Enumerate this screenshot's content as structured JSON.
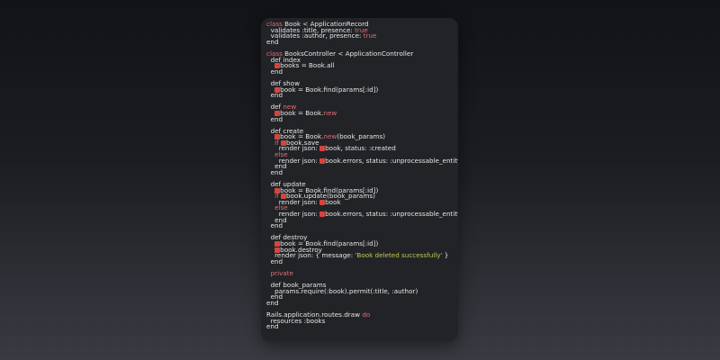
{
  "editor": {
    "accent_keyword": "#e06c75",
    "accent_string": "#c3c94e",
    "lines": [
      [
        {
          "t": "class",
          "c": "kw"
        },
        {
          "t": " Book < ApplicationRecord",
          "c": "tx"
        }
      ],
      [
        {
          "t": "  validates :title, presence: ",
          "c": "tx"
        },
        {
          "t": "true",
          "c": "kw"
        }
      ],
      [
        {
          "t": "  validates :author, presence: ",
          "c": "tx"
        },
        {
          "t": "true",
          "c": "kw"
        }
      ],
      [
        {
          "t": "end",
          "c": "tx"
        }
      ],
      [],
      [
        {
          "t": "class",
          "c": "kw"
        },
        {
          "t": " BooksController < ApplicationController",
          "c": "tx"
        }
      ],
      [
        {
          "t": "  def index",
          "c": "tx"
        }
      ],
      [
        {
          "t": "    ",
          "c": "tx"
        },
        {
          "t": "@",
          "c": "iv"
        },
        {
          "t": "books = Book.all",
          "c": "tx"
        }
      ],
      [
        {
          "t": "  end",
          "c": "tx"
        }
      ],
      [],
      [
        {
          "t": "  def show",
          "c": "tx"
        }
      ],
      [
        {
          "t": "    ",
          "c": "tx"
        },
        {
          "t": "@",
          "c": "iv"
        },
        {
          "t": "book = Book.find(params[:id])",
          "c": "tx"
        }
      ],
      [
        {
          "t": "  end",
          "c": "tx"
        }
      ],
      [],
      [
        {
          "t": "  def ",
          "c": "tx"
        },
        {
          "t": "new",
          "c": "kw"
        }
      ],
      [
        {
          "t": "    ",
          "c": "tx"
        },
        {
          "t": "@",
          "c": "iv"
        },
        {
          "t": "book = Book.",
          "c": "tx"
        },
        {
          "t": "new",
          "c": "kw"
        }
      ],
      [
        {
          "t": "  end",
          "c": "tx"
        }
      ],
      [],
      [
        {
          "t": "  def create",
          "c": "tx"
        }
      ],
      [
        {
          "t": "    ",
          "c": "tx"
        },
        {
          "t": "@",
          "c": "iv"
        },
        {
          "t": "book = Book.",
          "c": "tx"
        },
        {
          "t": "new",
          "c": "kw"
        },
        {
          "t": "(book_params)",
          "c": "tx"
        }
      ],
      [
        {
          "t": "    ",
          "c": "tx"
        },
        {
          "t": "if",
          "c": "kw"
        },
        {
          "t": " ",
          "c": "tx"
        },
        {
          "t": "@",
          "c": "iv"
        },
        {
          "t": "book.save",
          "c": "tx"
        }
      ],
      [
        {
          "t": "      render json: ",
          "c": "tx"
        },
        {
          "t": "@",
          "c": "iv"
        },
        {
          "t": "book, status: :created",
          "c": "tx"
        }
      ],
      [
        {
          "t": "    ",
          "c": "tx"
        },
        {
          "t": "else",
          "c": "kw"
        }
      ],
      [
        {
          "t": "      render json: ",
          "c": "tx"
        },
        {
          "t": "@",
          "c": "iv"
        },
        {
          "t": "book.errors, status: :unprocessable_entity",
          "c": "tx"
        }
      ],
      [
        {
          "t": "    end",
          "c": "tx"
        }
      ],
      [
        {
          "t": "  end",
          "c": "tx"
        }
      ],
      [],
      [
        {
          "t": "  def update",
          "c": "tx"
        }
      ],
      [
        {
          "t": "    ",
          "c": "tx"
        },
        {
          "t": "@",
          "c": "iv"
        },
        {
          "t": "book = Book.find(params[:id])",
          "c": "tx"
        }
      ],
      [
        {
          "t": "    ",
          "c": "tx"
        },
        {
          "t": "if",
          "c": "kw"
        },
        {
          "t": " ",
          "c": "tx"
        },
        {
          "t": "@",
          "c": "iv"
        },
        {
          "t": "book.update(book_params)",
          "c": "tx"
        }
      ],
      [
        {
          "t": "      render json: ",
          "c": "tx"
        },
        {
          "t": "@",
          "c": "iv"
        },
        {
          "t": "book",
          "c": "tx"
        }
      ],
      [
        {
          "t": "    ",
          "c": "tx"
        },
        {
          "t": "else",
          "c": "kw"
        }
      ],
      [
        {
          "t": "      render json: ",
          "c": "tx"
        },
        {
          "t": "@",
          "c": "iv"
        },
        {
          "t": "book.errors, status: :unprocessable_entity",
          "c": "tx"
        }
      ],
      [
        {
          "t": "    end",
          "c": "tx"
        }
      ],
      [
        {
          "t": "  end",
          "c": "tx"
        }
      ],
      [],
      [
        {
          "t": "  def destroy",
          "c": "tx"
        }
      ],
      [
        {
          "t": "    ",
          "c": "tx"
        },
        {
          "t": "@",
          "c": "iv"
        },
        {
          "t": "book = Book.find(params[:id])",
          "c": "tx"
        }
      ],
      [
        {
          "t": "    ",
          "c": "tx"
        },
        {
          "t": "@",
          "c": "iv"
        },
        {
          "t": "book.destroy",
          "c": "tx"
        }
      ],
      [
        {
          "t": "    render json: { message: ",
          "c": "tx"
        },
        {
          "t": "'Book deleted successfully'",
          "c": "str"
        },
        {
          "t": " }",
          "c": "tx"
        }
      ],
      [
        {
          "t": "  end",
          "c": "tx"
        }
      ],
      [],
      [
        {
          "t": "  ",
          "c": "tx"
        },
        {
          "t": "private",
          "c": "kw"
        }
      ],
      [],
      [
        {
          "t": "  def book_params",
          "c": "tx"
        }
      ],
      [
        {
          "t": "    params.require(:book).permit(:title, :author)",
          "c": "tx"
        }
      ],
      [
        {
          "t": "  end",
          "c": "tx"
        }
      ],
      [
        {
          "t": "end",
          "c": "tx"
        }
      ],
      [],
      [
        {
          "t": "Rails.application.routes.draw ",
          "c": "tx"
        },
        {
          "t": "do",
          "c": "kw"
        }
      ],
      [
        {
          "t": "  resources :books",
          "c": "tx"
        }
      ],
      [
        {
          "t": "end",
          "c": "tx"
        }
      ]
    ]
  }
}
